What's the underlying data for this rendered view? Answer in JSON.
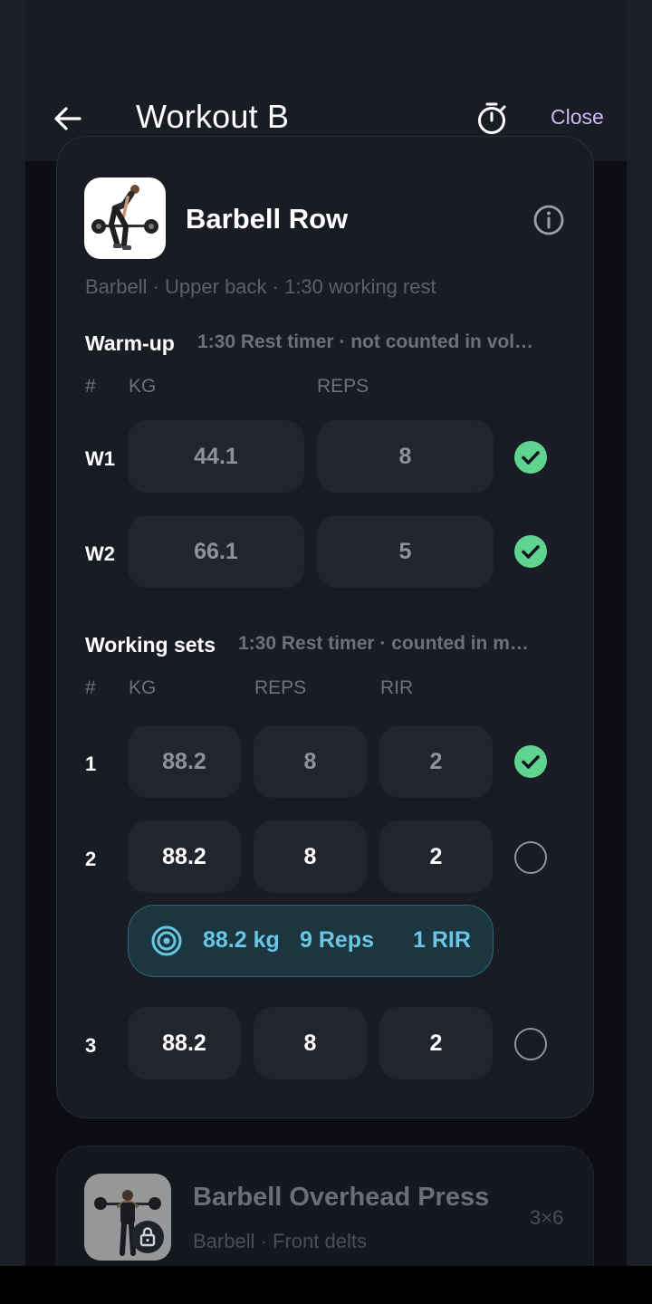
{
  "header": {
    "title": "Workout B",
    "close_label": "Close",
    "back_icon": "arrow-left-icon",
    "timer_icon": "stopwatch-icon"
  },
  "exercise": {
    "name": "Barbell Row",
    "meta": "Barbell · Upper back · 1:30 working rest",
    "info_icon": "info-icon",
    "warmup": {
      "title": "Warm-up",
      "subtitle": "1:30 Rest timer · not counted in vol…",
      "headers": [
        "#",
        "KG",
        "REPS"
      ],
      "rows": [
        {
          "label": "W1",
          "kg": "44.1",
          "reps": "8",
          "done": true
        },
        {
          "label": "W2",
          "kg": "66.1",
          "reps": "5",
          "done": true
        }
      ]
    },
    "working": {
      "title": "Working sets",
      "subtitle": "1:30 Rest timer · counted in m…",
      "headers": [
        "#",
        "KG",
        "REPS",
        "RIR"
      ],
      "rows": [
        {
          "label": "1",
          "kg": "88.2",
          "reps": "8",
          "rir": "2",
          "done": true
        },
        {
          "label": "2",
          "kg": "88.2",
          "reps": "8",
          "rir": "2",
          "done": false
        },
        {
          "label": "3",
          "kg": "88.2",
          "reps": "8",
          "rir": "2",
          "done": false
        }
      ],
      "suggestion": {
        "kg": "88.2 kg",
        "reps": "9 Reps",
        "rir": "1 RIR",
        "icon": "target-icon"
      }
    }
  },
  "next_exercise": {
    "name": "Barbell Overhead Press",
    "meta": "Barbell · Front delts",
    "scheme": "3×6",
    "lock_icon": "lock-icon"
  },
  "colors": {
    "accent": "#cdb8f5",
    "check": "#5fd38f",
    "suggest_text": "#69c6e4"
  }
}
